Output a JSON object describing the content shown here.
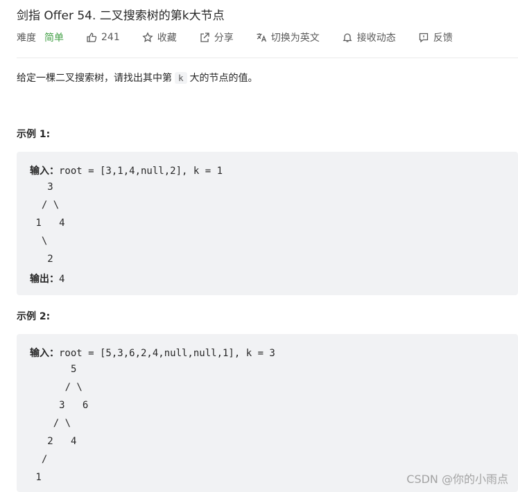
{
  "problem": {
    "title": "剑指 Offer 54. 二叉搜索树的第k大节点",
    "difficulty_label": "难度",
    "difficulty_value": "简单",
    "likes": "241",
    "favorite_label": "收藏",
    "share_label": "分享",
    "switch_lang_label": "切换为英文",
    "subscribe_label": "接收动态",
    "feedback_label": "反馈"
  },
  "description": {
    "before": "给定一棵二叉搜索树，请找出其中第",
    "code": "k",
    "after": "大的节点的值。"
  },
  "examples": [
    {
      "title": "示例 1:",
      "input_label": "输入：",
      "input_value": "root = [3,1,4,null,2], k = 1",
      "tree_lines": [
        "   3",
        "  / \\",
        " 1   4",
        "  \\",
        "   2"
      ],
      "output_label": "输出：",
      "output_value": "4"
    },
    {
      "title": "示例 2:",
      "input_label": "输入：",
      "input_value": "root = [5,3,6,2,4,null,null,1], k = 3",
      "tree_lines": [
        "       5",
        "      / \\",
        "     3   6",
        "    / \\",
        "   2   4",
        "  /",
        " 1"
      ]
    }
  ],
  "watermark": "CSDN @你的小雨点",
  "colors": {
    "easy": "#43a047",
    "code_bg": "#f1f2f4",
    "text": "#262626",
    "muted": "#595959"
  }
}
